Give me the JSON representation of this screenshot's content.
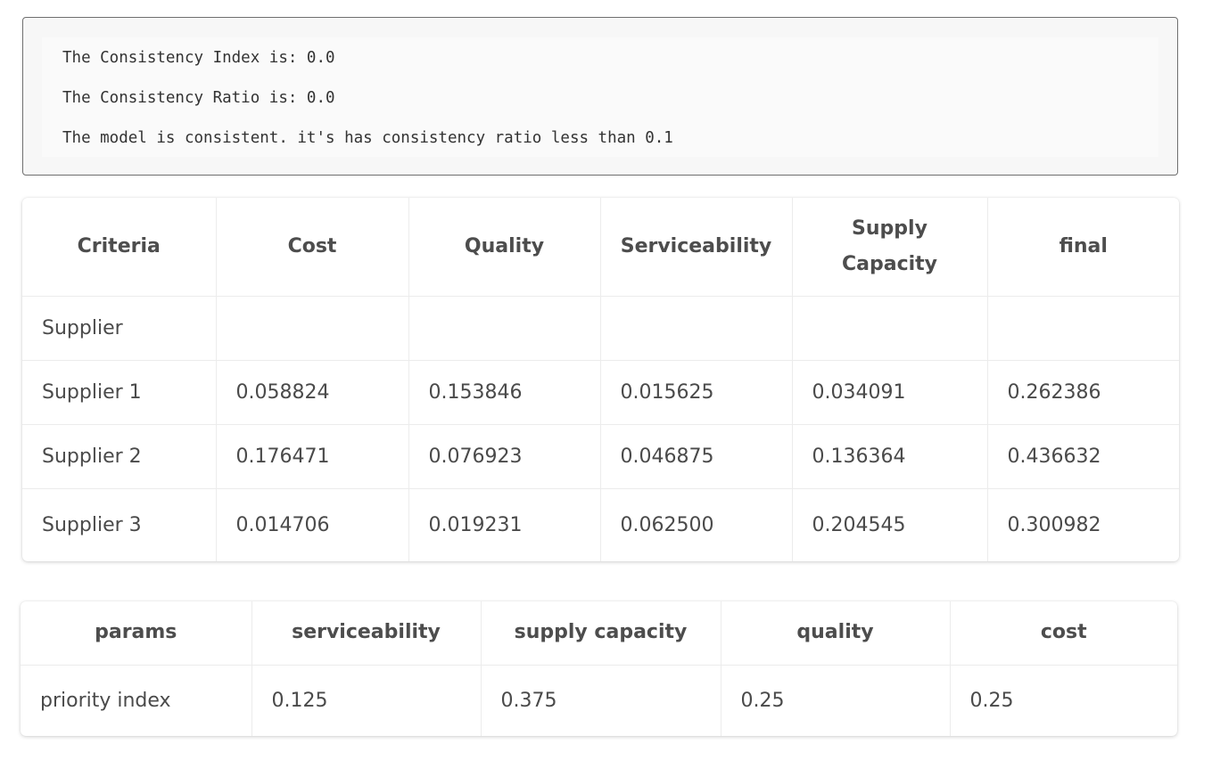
{
  "output": {
    "lines": [
      "The Consistency Index is: 0.0",
      "The Consistency Ratio is: 0.0",
      "The model is consistent. it's has consistency ratio less than 0.1"
    ]
  },
  "weights_table": {
    "headers": [
      "Criteria",
      "Cost",
      "Quality",
      "Serviceability",
      "Supply Capacity",
      "final"
    ],
    "rows": [
      [
        "Supplier",
        "",
        "",
        "",
        "",
        ""
      ],
      [
        "Supplier 1",
        "0.058824",
        "0.153846",
        "0.015625",
        "0.034091",
        "0.262386"
      ],
      [
        "Supplier 2",
        "0.176471",
        "0.076923",
        "0.046875",
        "0.136364",
        "0.436632"
      ],
      [
        "Supplier 3",
        "0.014706",
        "0.019231",
        "0.062500",
        "0.204545",
        "0.300982"
      ]
    ]
  },
  "priority_table": {
    "headers": [
      "params",
      "serviceability",
      "supply capacity",
      "quality",
      "cost"
    ],
    "rows": [
      [
        "priority index",
        "0.125",
        "0.375",
        "0.25",
        "0.25"
      ]
    ]
  }
}
